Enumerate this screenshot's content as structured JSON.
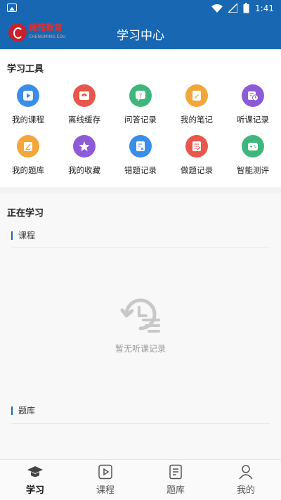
{
  "status_bar": {
    "time": "1:41"
  },
  "header": {
    "title": "学习中心",
    "logo_text": "诚铭教育",
    "logo_subtext": "CHENGMING EDU"
  },
  "tools": {
    "title": "学习工具",
    "items": [
      {
        "label": "我的课程",
        "icon": "play-icon",
        "color": "#3a8ee6"
      },
      {
        "label": "离线缓存",
        "icon": "cloud-download-icon",
        "color": "#e9574b"
      },
      {
        "label": "问答记录",
        "icon": "question-chat-icon",
        "color": "#3fb77c"
      },
      {
        "label": "我的笔记",
        "icon": "note-icon",
        "color": "#f2a73b"
      },
      {
        "label": "听课记录",
        "icon": "history-icon",
        "color": "#8e5bd6"
      },
      {
        "label": "我的题库",
        "icon": "edit-icon",
        "color": "#f2a73b"
      },
      {
        "label": "我的收藏",
        "icon": "star-icon",
        "color": "#8e5bd6"
      },
      {
        "label": "错题记录",
        "icon": "wrong-list-icon",
        "color": "#3a8ee6"
      },
      {
        "label": "做题记录",
        "icon": "exercise-icon",
        "color": "#e9574b"
      },
      {
        "label": "智能测评",
        "icon": "gamepad-icon",
        "color": "#3fb77c"
      }
    ]
  },
  "studying": {
    "title": "正在学习",
    "course_label": "课程",
    "empty_text": "暂无听课记录",
    "bank_label": "题库"
  },
  "tabbar": {
    "tabs": [
      {
        "label": "学习",
        "icon": "graduation-cap-icon",
        "active": true
      },
      {
        "label": "课程",
        "icon": "play-square-icon",
        "active": false
      },
      {
        "label": "题库",
        "icon": "document-icon",
        "active": false
      },
      {
        "label": "我的",
        "icon": "user-icon",
        "active": false
      }
    ]
  }
}
